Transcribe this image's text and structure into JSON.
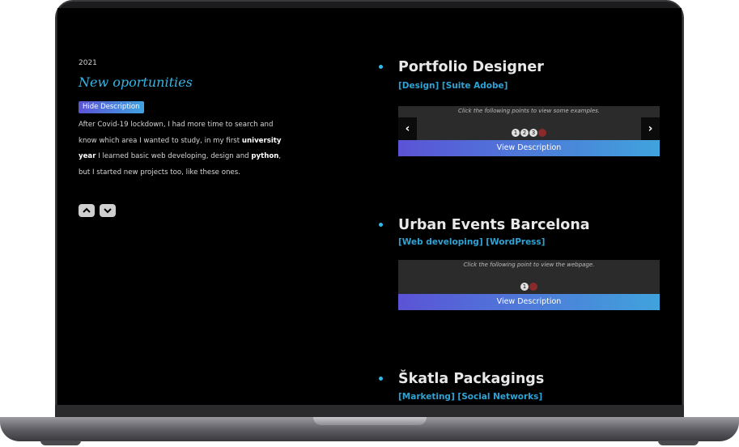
{
  "left": {
    "year": "2021",
    "title": "New oportunities",
    "hide_button": "Hide Description",
    "desc": {
      "p1": "After Covid-19 lockdown, I had more time to search and know which area I wanted to study, in my first ",
      "b1": "university year",
      "p2": " I learned basic web developing, design and ",
      "b2": "python",
      "p3": ", but I started new projects too, like these ones."
    },
    "up_icon": "chevron-up-icon",
    "down_icon": "chevron-down-icon"
  },
  "projects": [
    {
      "title": "Portfolio Designer",
      "tags": "[Design] [Suite Adobe]",
      "hint": "Click the following points to view some examples.",
      "dots": [
        "1",
        "2",
        "3",
        ""
      ],
      "view_button": "View Description"
    },
    {
      "title": "Urban Events Barcelona",
      "tags": "[Web developing] [WordPress]",
      "hint": "Click the following point to view the webpage.",
      "dots": [
        "1",
        ""
      ],
      "view_button": "View Description"
    },
    {
      "title": "Škatla Packagings",
      "tags": "[Marketing] [Social Networks]"
    }
  ],
  "nav": {
    "prev": "‹",
    "next": "›"
  },
  "colors": {
    "accent": "#37b6e6",
    "tag": "#2ea3d6",
    "grad_start": "#5b53d6",
    "grad_end": "#40a3dc",
    "dot_active": "#8b2a2a"
  }
}
